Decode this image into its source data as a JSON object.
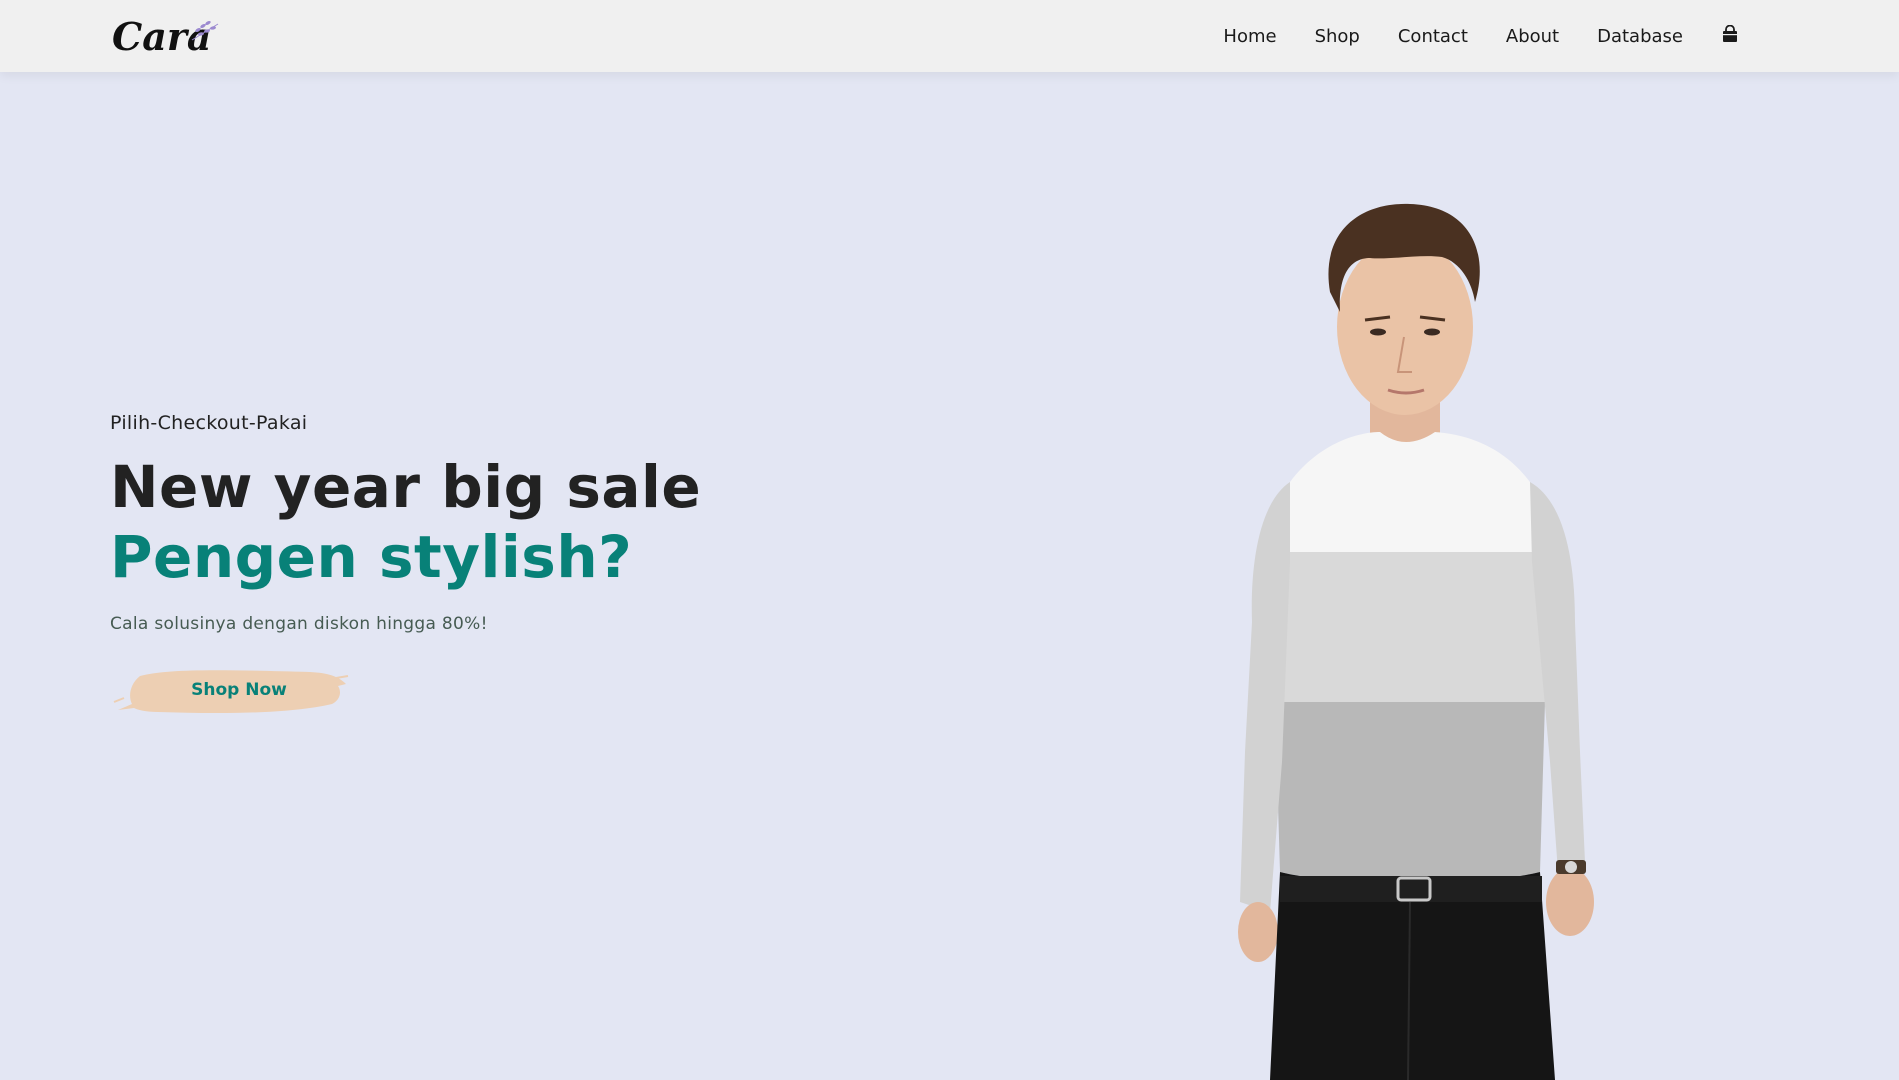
{
  "header": {
    "logo_text": "Cara",
    "nav": [
      {
        "label": "Home"
      },
      {
        "label": "Shop"
      },
      {
        "label": "Contact"
      },
      {
        "label": "About"
      },
      {
        "label": "Database"
      }
    ],
    "cart_icon": "shopping-bag-icon"
  },
  "hero": {
    "tagline": "Pilih-Checkout-Pakai",
    "headline": "New year big sale",
    "subheadline": "Pengen stylish?",
    "description": "Cala solusinya dengan diskon hingga 80%!",
    "cta_label": "Shop Now"
  },
  "colors": {
    "background": "#E3E6F3",
    "header_bg": "#F0F0F0",
    "accent": "#088178",
    "button_brush": "#EDCFB3",
    "text_dark": "#222222"
  }
}
